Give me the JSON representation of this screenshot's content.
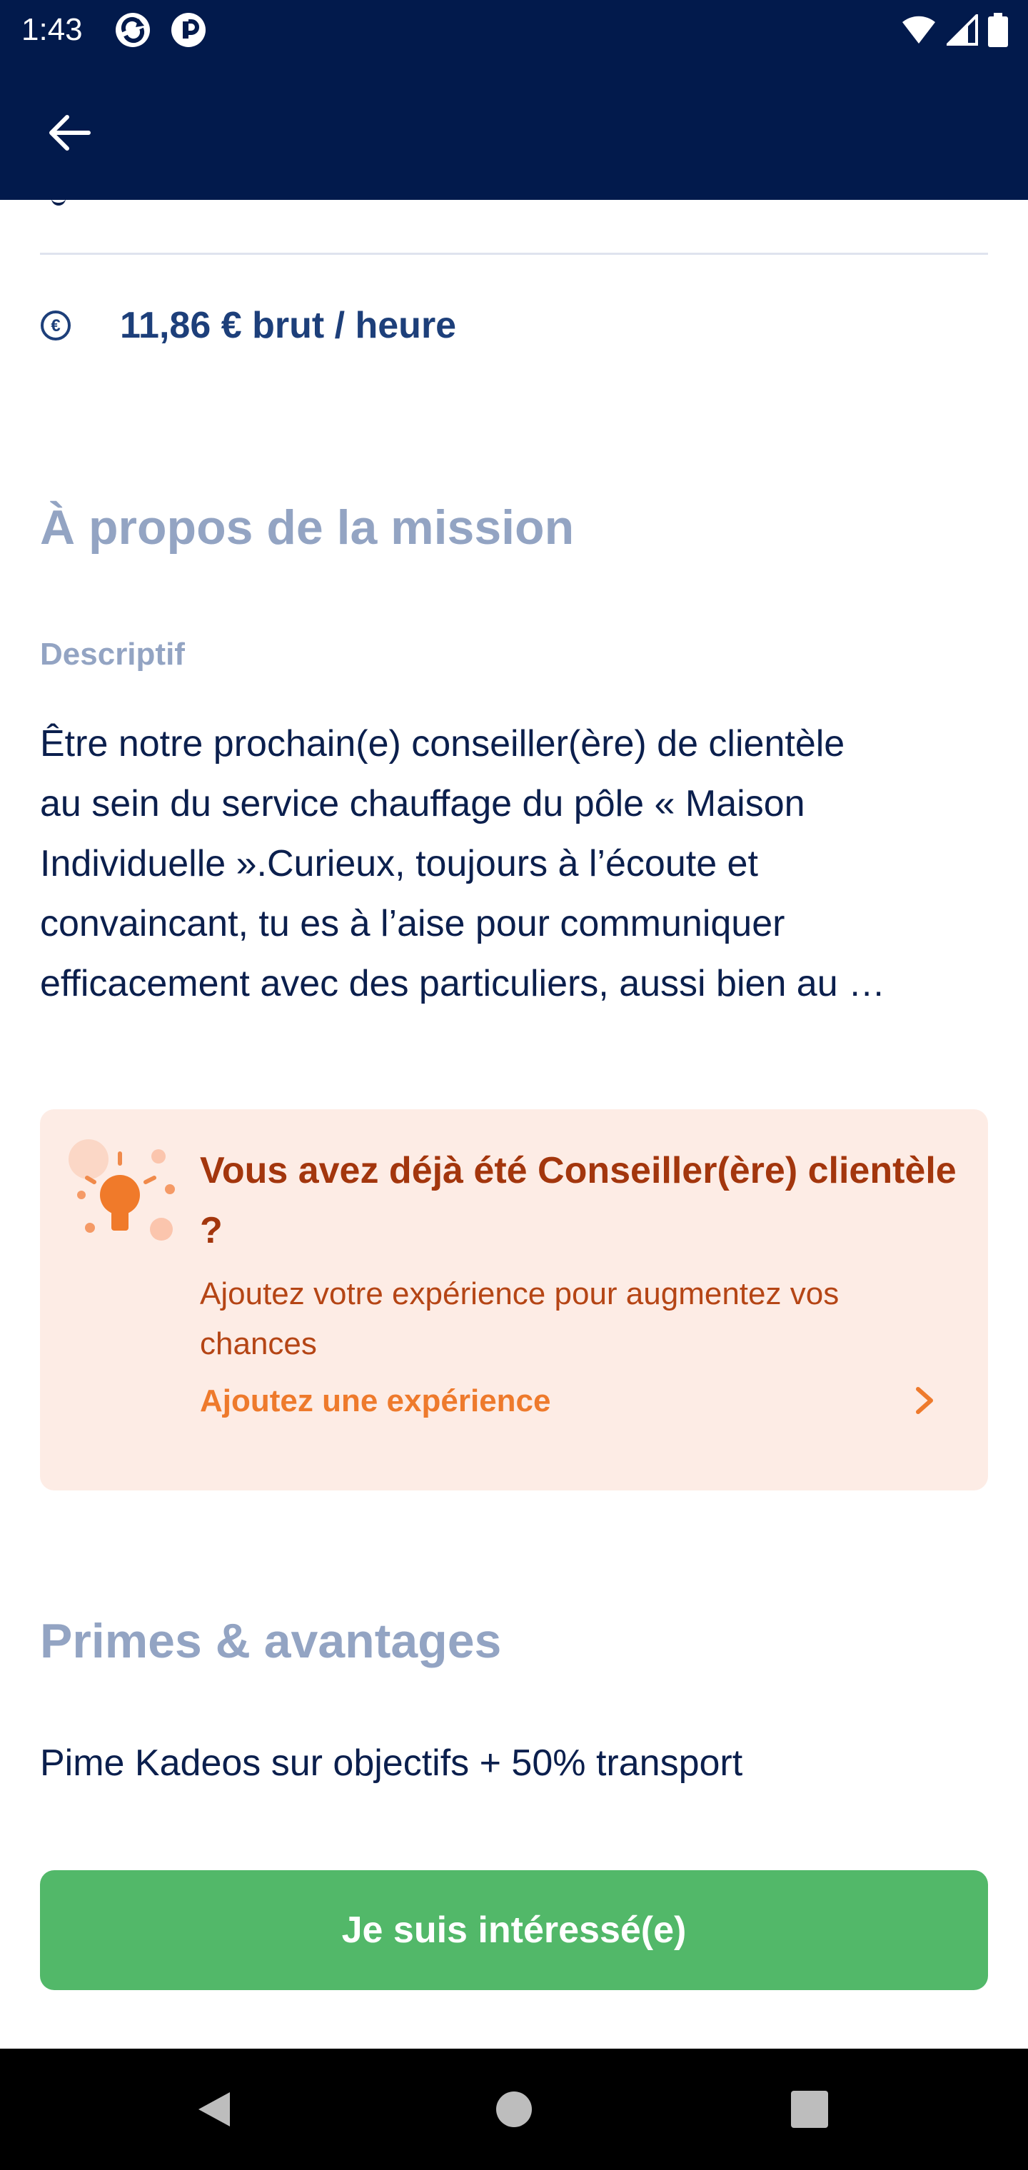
{
  "status_bar": {
    "time": "1:43",
    "app_icons": [
      "sync-badge-icon",
      "shield-badge-icon"
    ],
    "indicators": [
      "wifi-icon",
      "signal-icon",
      "battery-icon"
    ]
  },
  "app_bar": {
    "back_icon": "arrow-left-icon"
  },
  "salary": {
    "icon": "euro-icon",
    "text": "11,86 € brut / heure"
  },
  "mission": {
    "title": "À propos de la mission",
    "label": "Descriptif",
    "lines": [
      "Être notre prochain(e) conseiller(ère) de clientèle",
      "au sein du service chauffage du pôle « Maison",
      "Individuelle ».Curieux, toujours à l’écoute et",
      "convaincant, tu es à l’aise pour communiquer",
      "efficacement avec des particuliers, aussi bien au …"
    ]
  },
  "experience_card": {
    "icon": "lightbulb-icon",
    "title": "Vous avez déjà été Conseiller(ère) clientèle ?",
    "subtitle": "Ajoutez votre expérience pour augmentez vos chances",
    "link": "Ajoutez une expérience",
    "chevron": "chevron-right-icon",
    "bg_color": "#fdece5",
    "accent_color": "#ee7a2c"
  },
  "benefits": {
    "title": "Primes & avantages",
    "text": "Pime Kadeos sur objectifs + 50% transport"
  },
  "cta": {
    "label": "Je suis intéressé(e)",
    "color": "#52b869"
  },
  "nav_bar": {
    "buttons": [
      "back-triangle-icon",
      "home-circle-icon",
      "recents-square-icon"
    ]
  },
  "colors": {
    "header_bg": "#021a4c",
    "heading_muted": "#93a4c3",
    "text_primary": "#0b1f4d"
  }
}
